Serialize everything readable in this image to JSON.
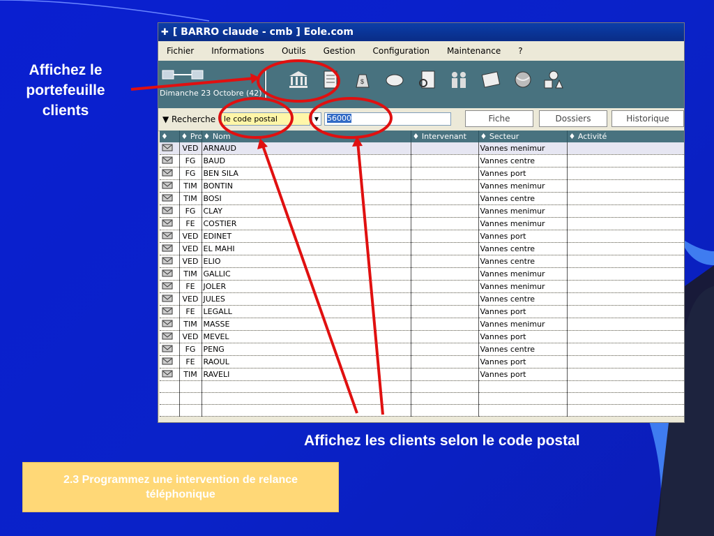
{
  "annotations": {
    "left": "Affichez le portefeuille clients",
    "bottom": "Affichez les clients selon le code postal",
    "note": "2.3 Programmez une intervention de relance téléphonique"
  },
  "window": {
    "title": "[ BARRO claude - cmb ] Eole.com",
    "menu": [
      "Fichier",
      "Informations",
      "Outils",
      "Gestion",
      "Configuration",
      "Maintenance",
      "?"
    ],
    "date": "Dimanche 23 Octobre (42)",
    "toolbar_icons": [
      "bank-icon",
      "document-icon",
      "money-bag-icon",
      "hand-icon",
      "search-document-icon",
      "people-icon",
      "notepad-icon",
      "globe-icon",
      "shapes-icon"
    ]
  },
  "search": {
    "label": "Recherche",
    "criterion": "le code postal",
    "value": "56000",
    "buttons": [
      "Fiche",
      "Dossiers",
      "Historique"
    ]
  },
  "table": {
    "headers": [
      "Prof",
      "Nom",
      "Intervenant",
      "Secteur",
      "Activité"
    ],
    "rows": [
      {
        "prof": "VED",
        "nom": "ARNAUD",
        "secteur": "Vannes menimur"
      },
      {
        "prof": "FG",
        "nom": "BAUD",
        "secteur": "Vannes centre"
      },
      {
        "prof": "FG",
        "nom": "BEN SILA",
        "secteur": "Vannes port"
      },
      {
        "prof": "TIM",
        "nom": "BONTIN",
        "secteur": "Vannes menimur"
      },
      {
        "prof": "TIM",
        "nom": "BOSI",
        "secteur": "Vannes centre"
      },
      {
        "prof": "FG",
        "nom": "CLAY",
        "secteur": "Vannes menimur"
      },
      {
        "prof": "FE",
        "nom": "COSTIER",
        "secteur": "Vannes menimur"
      },
      {
        "prof": "VED",
        "nom": "EDINET",
        "secteur": "Vannes port"
      },
      {
        "prof": "VED",
        "nom": "EL MAHI",
        "secteur": "Vannes centre"
      },
      {
        "prof": "VED",
        "nom": "ELIO",
        "secteur": "Vannes centre"
      },
      {
        "prof": "TIM",
        "nom": "GALLIC",
        "secteur": "Vannes menimur"
      },
      {
        "prof": "FE",
        "nom": "JOLER",
        "secteur": "Vannes menimur"
      },
      {
        "prof": "VED",
        "nom": "JULES",
        "secteur": "Vannes centre"
      },
      {
        "prof": "FE",
        "nom": "LEGALL",
        "secteur": "Vannes port"
      },
      {
        "prof": "TIM",
        "nom": "MASSE",
        "secteur": "Vannes menimur"
      },
      {
        "prof": "VED",
        "nom": "MEVEL",
        "secteur": "Vannes port"
      },
      {
        "prof": "FG",
        "nom": "PENG",
        "secteur": "Vannes centre"
      },
      {
        "prof": "FE",
        "nom": "RAOUL",
        "secteur": "Vannes port"
      },
      {
        "prof": "TIM",
        "nom": "RAVELI",
        "secteur": "Vannes port"
      }
    ]
  },
  "colors": {
    "background": "#0a1fd0",
    "annotation_red": "#e01010",
    "note_box": "#ffd877",
    "toolbar": "#48727f"
  }
}
